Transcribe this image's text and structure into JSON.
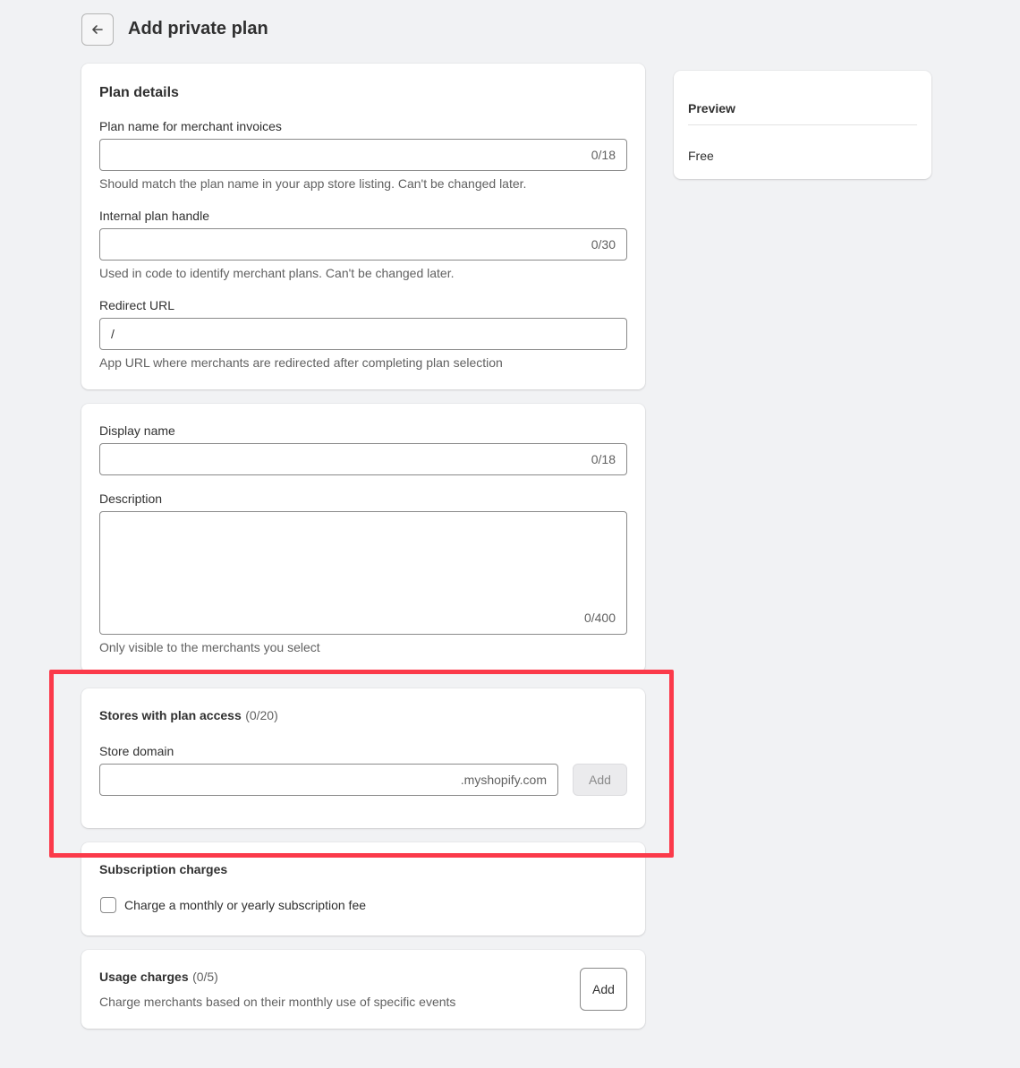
{
  "header": {
    "back_icon": "arrow-left-icon",
    "title": "Add private plan"
  },
  "plan_details": {
    "title": "Plan details",
    "plan_name": {
      "label": "Plan name for merchant invoices",
      "value": "",
      "counter": "0/18",
      "help": "Should match the plan name in your app store listing. Can't be changed later."
    },
    "handle": {
      "label": "Internal plan handle",
      "value": "",
      "counter": "0/30",
      "help": "Used in code to identify merchant plans. Can't be changed later."
    },
    "redirect": {
      "label": "Redirect URL",
      "value": "/",
      "help": "App URL where merchants are redirected after completing plan selection"
    }
  },
  "display": {
    "display_name": {
      "label": "Display name",
      "value": "",
      "counter": "0/18"
    },
    "description": {
      "label": "Description",
      "value": "",
      "counter": "0/400",
      "help": "Only visible to the merchants you select"
    }
  },
  "stores": {
    "title": "Stores with plan access",
    "count": "(0/20)",
    "domain_label": "Store domain",
    "domain_value": "",
    "domain_suffix": ".myshopify.com",
    "add_label": "Add"
  },
  "subscription": {
    "title": "Subscription charges",
    "checkbox_label": "Charge a monthly or yearly subscription fee",
    "checked": false
  },
  "usage": {
    "title": "Usage charges",
    "count": "(0/5)",
    "help": "Charge merchants based on their monthly use of specific events",
    "add_label": "Add"
  },
  "preview": {
    "title": "Preview",
    "price": "Free"
  },
  "colors": {
    "highlight": "#fb3a4a",
    "background": "#f1f2f4",
    "card": "#ffffff"
  }
}
